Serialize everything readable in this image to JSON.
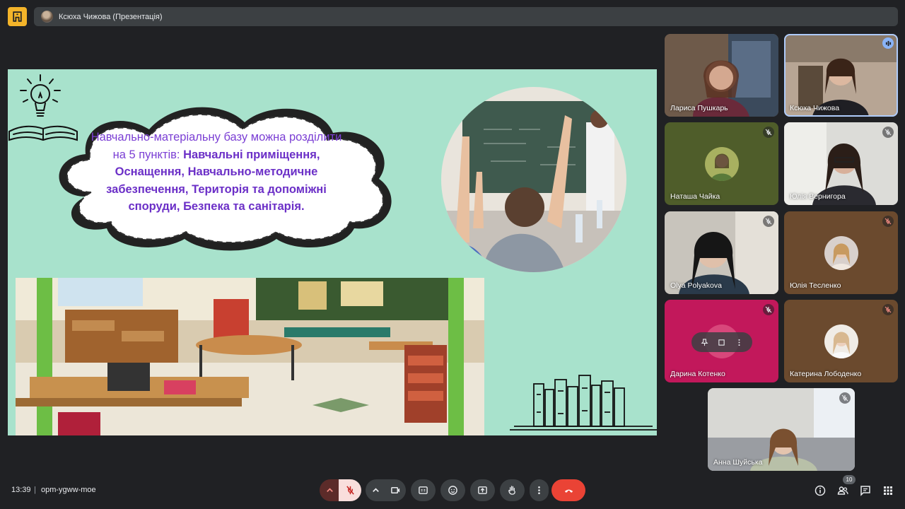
{
  "header": {
    "presenter_title": "Ксюха Чижова (Презентація)"
  },
  "slide": {
    "cloud_lead": "Навчально-матеріальну базу можна розділити на 5 пунктів: ",
    "cloud_bold": "Навчальні приміщення, Оснащення, Навчально-методичне забезпечення, Територія та допоміжні споруди, Безпека та санітарія."
  },
  "participants": [
    {
      "name": "Лариса Пушкарь",
      "status": "video"
    },
    {
      "name": "Ксюха Чижова",
      "status": "speaking"
    },
    {
      "name": "Наташа Чайка",
      "status": "muted"
    },
    {
      "name": "Юлія Вернигора",
      "status": "muted"
    },
    {
      "name": "Olya Polyakova",
      "status": "muted"
    },
    {
      "name": "Юлія Тесленко",
      "status": "muted"
    },
    {
      "name": "Дарина Котенко",
      "status": "muted"
    },
    {
      "name": "Катерина Лободенко",
      "status": "muted"
    },
    {
      "name": "Анна Шуйська",
      "status": "muted"
    }
  ],
  "footer": {
    "time": "13:39",
    "separator": "|",
    "meeting_code": "opm-ygww-moe",
    "people_count": "10"
  },
  "colors": {
    "slide_bg": "#a8e2cc",
    "accent_text": "#7b3fd4",
    "end_call": "#ea4335",
    "speaking_ring": "#8ab4f8"
  }
}
